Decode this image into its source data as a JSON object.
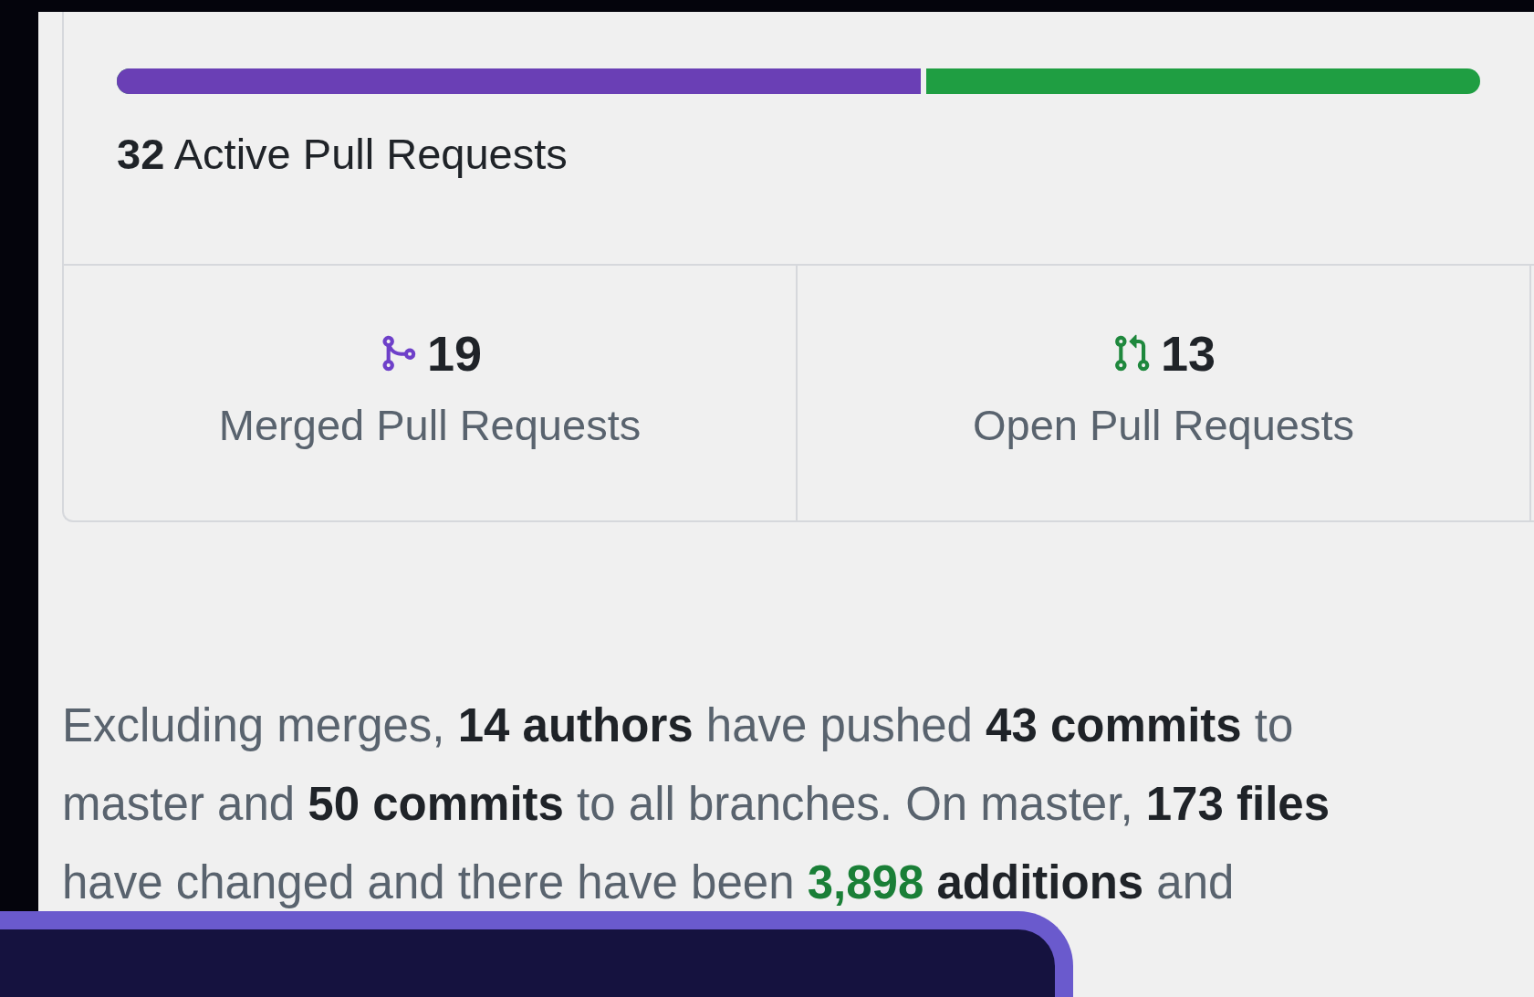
{
  "summary_card": {
    "progress": {
      "level": 0.594
    },
    "total_count": "32",
    "total_label": "Active Pull Requests",
    "stats": [
      {
        "kind": "merged",
        "count": "19",
        "label": "Merged Pull Requests"
      },
      {
        "kind": "open",
        "count": "13",
        "label": "Open Pull Requests"
      }
    ]
  },
  "commit_summary": [
    {
      "kind": "plain",
      "text": "Excluding merges, "
    },
    {
      "kind": "bold",
      "text": "14 authors"
    },
    {
      "kind": "plain",
      "text": " have pushed "
    },
    {
      "kind": "bold",
      "text": "43 commits"
    },
    {
      "kind": "plain",
      "text": " to master and "
    },
    {
      "kind": "bold",
      "text": "50 commits"
    },
    {
      "kind": "plain",
      "text": " to all branches. On master, "
    },
    {
      "kind": "bold",
      "text": "173 files"
    },
    {
      "kind": "plain",
      "text": " have changed and there have been "
    },
    {
      "kind": "added",
      "text": "3,898 "
    },
    {
      "kind": "bold",
      "text": "additions"
    },
    {
      "kind": "plain",
      "text": " and"
    }
  ]
}
